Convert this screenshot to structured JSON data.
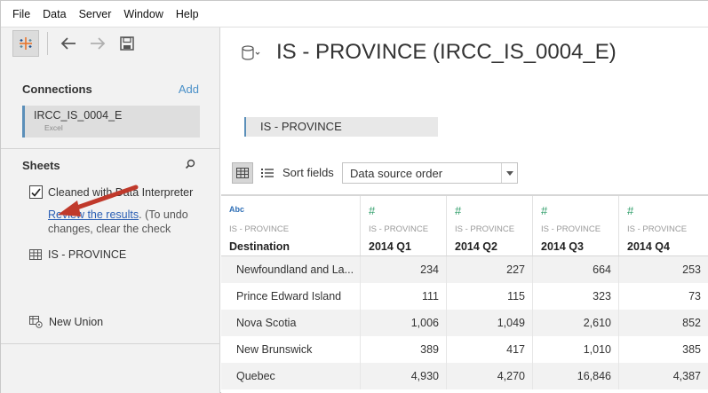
{
  "menu": [
    "File",
    "Data",
    "Server",
    "Window",
    "Help"
  ],
  "sidebar": {
    "connections_title": "Connections",
    "add_label": "Add",
    "connection": {
      "name": "IRCC_IS_0004_E",
      "type": "Excel"
    },
    "sheets_title": "Sheets",
    "interpreter_label": "Cleaned with Data Interpreter",
    "interpreter_checked": true,
    "review_link": "Review the results",
    "review_rest": ". (To undo changes, clear the check",
    "sheet_name": "IS - PROVINCE",
    "new_union": "New Union"
  },
  "main": {
    "title": "IS - PROVINCE (IRCC_IS_0004_E)",
    "pill_label": "IS - PROVINCE",
    "sort_label": "Sort fields",
    "sort_value": "Data source order"
  },
  "grid": {
    "columns": [
      {
        "type_label": "Abc",
        "type": "string",
        "source": "IS - PROVINCE",
        "name": "Destination"
      },
      {
        "type_label": "#",
        "type": "number",
        "source": "IS - PROVINCE",
        "name": "2014 Q1"
      },
      {
        "type_label": "#",
        "type": "number",
        "source": "IS - PROVINCE",
        "name": "2014 Q2"
      },
      {
        "type_label": "#",
        "type": "number",
        "source": "IS - PROVINCE",
        "name": "2014 Q3"
      },
      {
        "type_label": "#",
        "type": "number",
        "source": "IS - PROVINCE",
        "name": "2014 Q4"
      }
    ],
    "rows": [
      [
        "Newfoundland and La...",
        "234",
        "227",
        "664",
        "253"
      ],
      [
        "Prince Edward Island",
        "111",
        "115",
        "323",
        "73"
      ],
      [
        "Nova Scotia",
        "1,006",
        "1,049",
        "2,610",
        "852"
      ],
      [
        "New Brunswick",
        "389",
        "417",
        "1,010",
        "385"
      ],
      [
        "Quebec",
        "4,930",
        "4,270",
        "16,846",
        "4,387"
      ]
    ]
  },
  "colors": {
    "accent": "#5b8fb9",
    "link": "#2b5fb4",
    "annotation_arrow": "#c0392b",
    "numeric_type": "#2f9e6a",
    "string_type": "#2f6fb6"
  }
}
